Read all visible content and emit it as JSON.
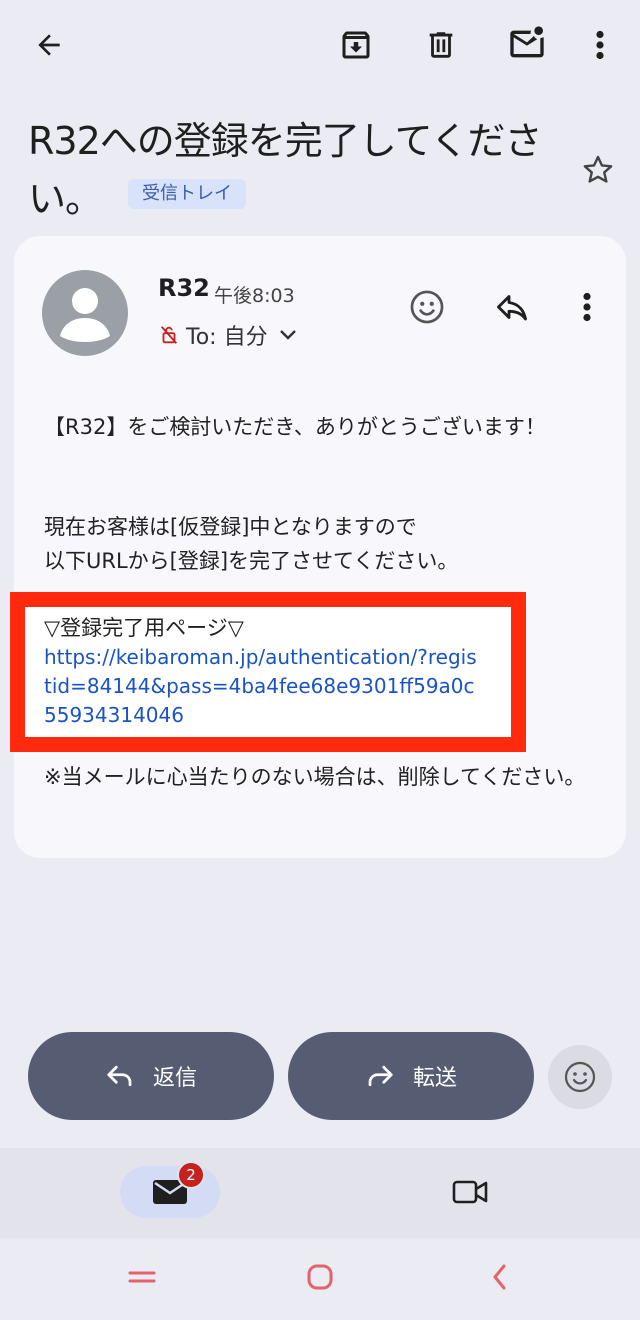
{
  "toolbar": {
    "back_icon": "arrow-left-icon",
    "archive_icon": "archive-icon",
    "delete_icon": "trash-icon",
    "mark_unread_icon": "mail-unread-icon",
    "more_icon": "more-vert-icon"
  },
  "subject": {
    "text": "R32への登録を完了してください。",
    "label_chip": "受信トレイ",
    "star_icon": "star-outline-icon"
  },
  "message": {
    "sender": "R32",
    "time": "午後8:03",
    "to_text": "To: 自分",
    "lock_icon": "lock-off-icon",
    "body_p1": "【R32】をご検討いただき、ありがとうございます！",
    "body_p2_l1": "現在お客様は[仮登録]中となりますので",
    "body_p2_l2": "以下URLから[登録]を完了させてください。",
    "link_heading": "▽登録完了用ページ▽",
    "link_url": "https://keibaroman.jp/authentication/?registid=84144&pass=4ba4fee68e9301ff59a0c55934314046",
    "footer_note": "※当メールに心当たりのない場合は、削除してください。"
  },
  "actions": {
    "reply_label": "返信",
    "forward_label": "転送"
  },
  "bottom_nav": {
    "mail_badge": "2"
  },
  "colors": {
    "accent": "#1a54c4",
    "highlight_border": "#ff2a0e",
    "pill_bg": "#565d73",
    "badge": "#c5221f"
  }
}
